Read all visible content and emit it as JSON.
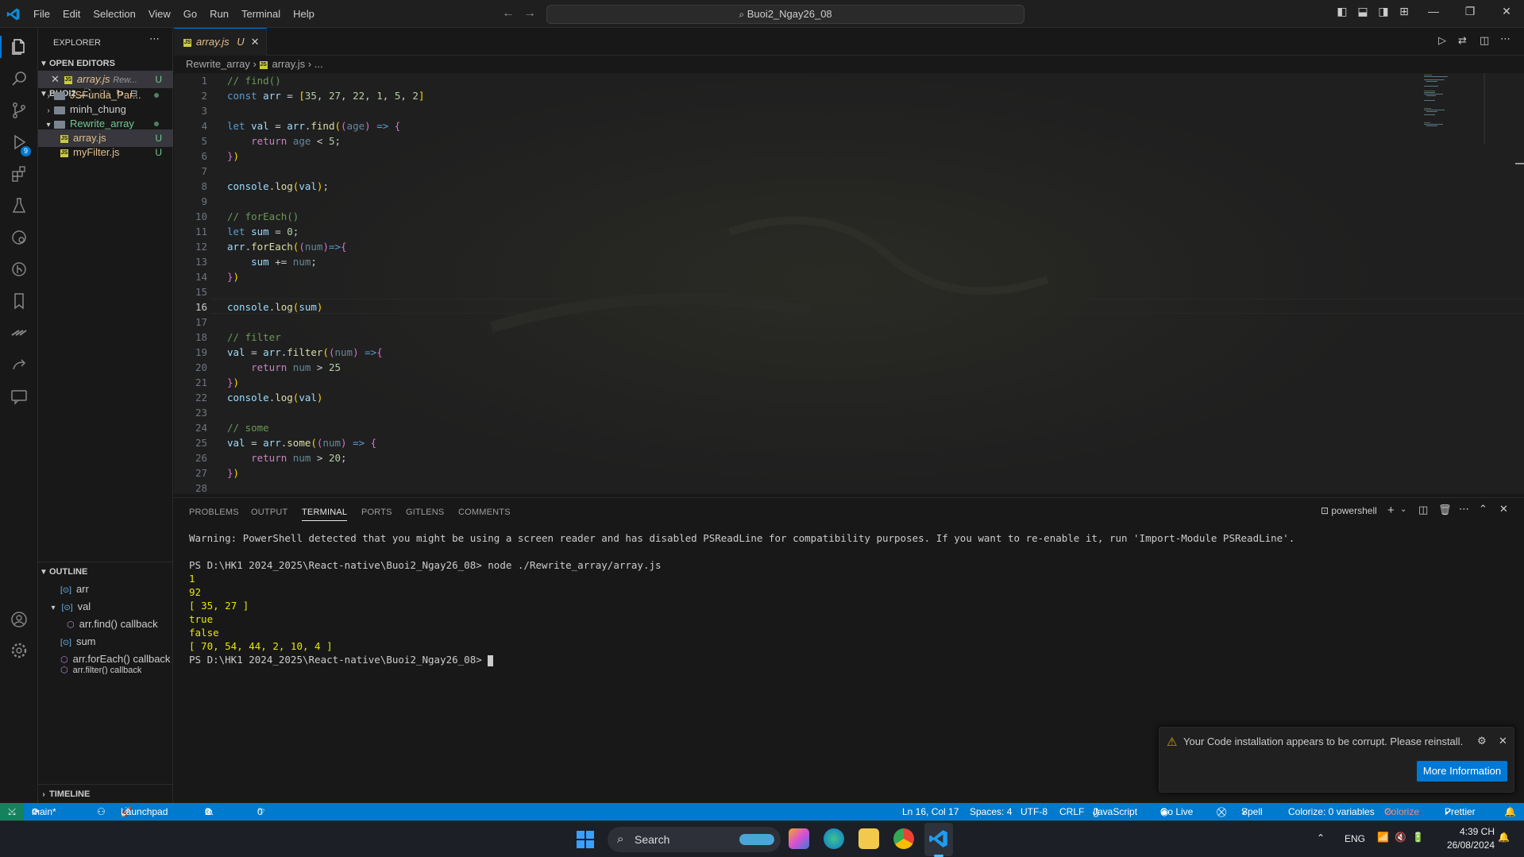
{
  "titlebar": {
    "menu": [
      "File",
      "Edit",
      "Selection",
      "View",
      "Go",
      "Run",
      "Terminal",
      "Help"
    ],
    "search": "Buoi2_Ngay26_08"
  },
  "sidebar": {
    "explorer_title": "EXPLORER",
    "open_editors_title": "OPEN EDITORS",
    "open_editor": {
      "name": "array.js",
      "path": "Rew...",
      "badge": "U"
    },
    "workspace_title": "BUOI2_...",
    "tree": [
      {
        "name": "JSFunda_Par...",
        "type": "folder",
        "expanded": false
      },
      {
        "name": "minh_chung",
        "type": "folder",
        "expanded": false
      },
      {
        "name": "Rewrite_array",
        "type": "folder",
        "expanded": true
      },
      {
        "name": "array.js",
        "type": "file",
        "badge": "U"
      },
      {
        "name": "myFilter.js",
        "type": "file",
        "badge": "U"
      }
    ],
    "outline_title": "OUTLINE",
    "outline": [
      {
        "name": "arr",
        "kind": "var"
      },
      {
        "name": "val",
        "kind": "var"
      },
      {
        "name": "arr.find() callback",
        "kind": "fn"
      },
      {
        "name": "sum",
        "kind": "var"
      },
      {
        "name": "arr.forEach() callback",
        "kind": "fn"
      },
      {
        "name": "arr.filter() callback",
        "kind": "fn"
      }
    ],
    "timeline_title": "TIMELINE",
    "scm_badge": "9"
  },
  "editor": {
    "tab": {
      "name": "array.js",
      "badge": "U"
    },
    "breadcrumb": {
      "folder": "Rewrite_array",
      "file": "array.js",
      "rest": "..."
    },
    "line_numbers": [
      "1",
      "2",
      "3",
      "4",
      "5",
      "6",
      "7",
      "8",
      "9",
      "10",
      "11",
      "12",
      "13",
      "14",
      "15",
      "16",
      "17",
      "18",
      "19",
      "20",
      "21",
      "22",
      "23",
      "24",
      "25",
      "26",
      "27",
      "28"
    ]
  },
  "panel": {
    "tabs": [
      "PROBLEMS",
      "OUTPUT",
      "TERMINAL",
      "PORTS",
      "GITLENS",
      "COMMENTS"
    ],
    "active_tab": "TERMINAL",
    "shell": "powershell",
    "warning": "Warning: PowerShell detected that you might be using a screen reader and has disabled PSReadLine for compatibility purposes. If you want to re-enable it, run 'Import-Module PSReadLine'.",
    "prompt1": "PS D:\\HK1 2024_2025\\React-native\\Buoi2_Ngay26_08> node ./Rewrite_array/array.js",
    "output": [
      "1",
      "92",
      "[ 35, 27 ]",
      "true",
      "false",
      "[ 70, 54, 44, 2, 10, 4 ]"
    ],
    "prompt2": "PS D:\\HK1 2024_2025\\React-native\\Buoi2_Ngay26_08> "
  },
  "notification": {
    "message": "Your Code installation appears to be corrupt. Please reinstall.",
    "button": "More Information"
  },
  "statusbar": {
    "branch": "main*",
    "launchpad": "Launchpad",
    "errors": "0",
    "warnings": "0",
    "ports": "0",
    "position": "Ln 16, Col 17",
    "spaces": "Spaces: 4",
    "encoding": "UTF-8",
    "eol": "CRLF",
    "language": "JavaScript",
    "golive": "Go Live",
    "spell": "Spell",
    "colorize_vars": "Colorize: 0 variables",
    "colorize": "Colorize",
    "prettier": "Prettier"
  },
  "taskbar": {
    "search": "Search",
    "lang": "ENG",
    "time": "4:39 CH",
    "date": "26/08/2024"
  },
  "colors": {
    "accent": "#0078d4",
    "statusbar": "#007acc",
    "remote": "#16825d",
    "git_untracked": "#73c991",
    "modified": "#e2c08d"
  }
}
